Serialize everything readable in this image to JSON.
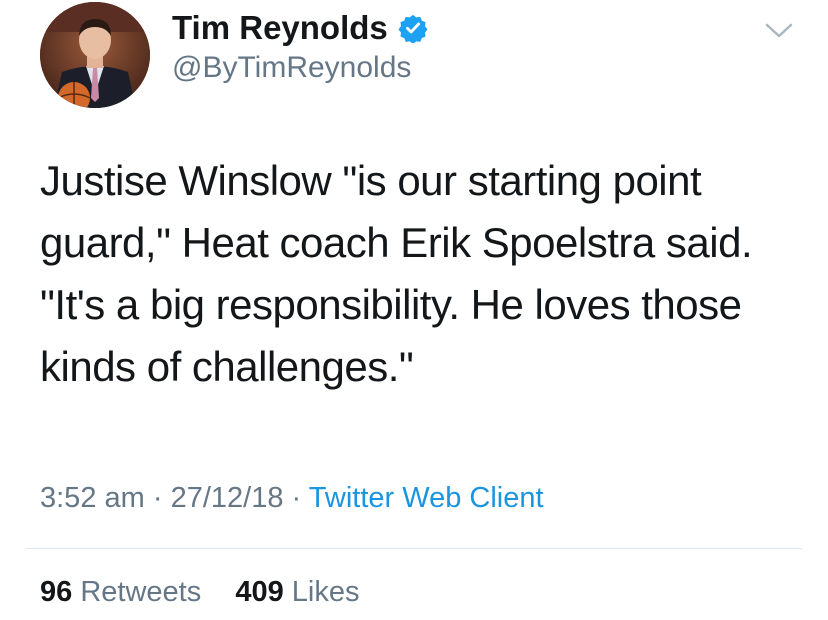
{
  "author": {
    "name": "Tim Reynolds",
    "handle": "@ByTimReynolds",
    "verified_icon": "verified-badge-icon"
  },
  "tweet": {
    "text": "Justise Winslow \"is our starting point guard,\" Heat coach Erik Spoelstra said. \"It's a big responsibility. He loves those kinds of challenges.\"",
    "time": "3:52 am",
    "separator": "·",
    "date": "27/12/18",
    "client": "Twitter Web Client"
  },
  "stats": {
    "retweets_count": "96",
    "retweets_label": "Retweets",
    "likes_count": "409",
    "likes_label": "Likes"
  },
  "colors": {
    "text": "#14171a",
    "secondary": "#657786",
    "link": "#1b95e0",
    "verified": "#1da1f2",
    "divider": "#e1e8ed"
  },
  "icons": {
    "menu": "chevron-down-icon"
  }
}
